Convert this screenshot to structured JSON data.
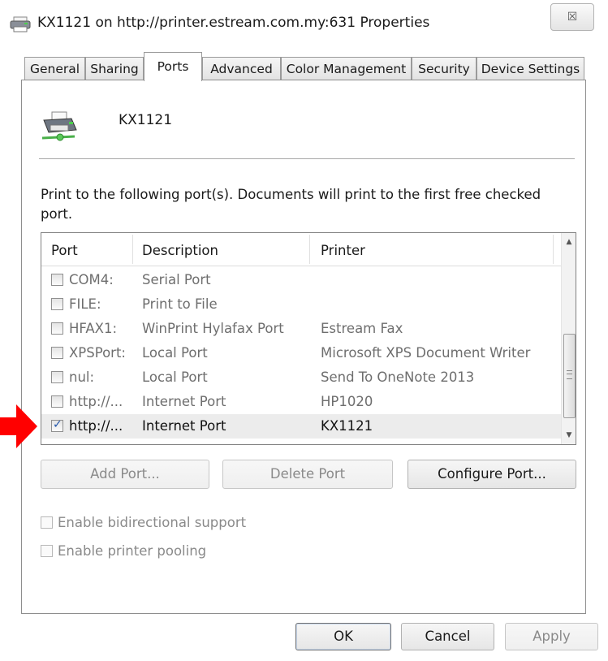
{
  "window": {
    "title": "KX1121 on http://printer.estream.com.my:631 Properties",
    "close_glyph": "☒",
    "icons": {
      "title": "printer-icon",
      "close": "close-icon"
    }
  },
  "tabs": [
    {
      "label": "General",
      "active": false
    },
    {
      "label": "Sharing",
      "active": false
    },
    {
      "label": "Ports",
      "active": true
    },
    {
      "label": "Advanced",
      "active": false
    },
    {
      "label": "Color Management",
      "active": false
    },
    {
      "label": "Security",
      "active": false
    },
    {
      "label": "Device Settings",
      "active": false
    }
  ],
  "printer": {
    "name": "KX1121",
    "icon": "network-printer-icon"
  },
  "description": "Print to the following port(s). Documents will print to the first free checked port.",
  "port_list": {
    "headers": {
      "port": "Port",
      "description": "Description",
      "printer": "Printer"
    },
    "rows": [
      {
        "port": "COM4:",
        "description": "Serial Port",
        "printer": "",
        "checked": false,
        "selected": false
      },
      {
        "port": "FILE:",
        "description": "Print to File",
        "printer": "",
        "checked": false,
        "selected": false
      },
      {
        "port": "HFAX1:",
        "description": "WinPrint Hylafax Port",
        "printer": "Estream Fax",
        "checked": false,
        "selected": false
      },
      {
        "port": "XPSPort:",
        "description": "Local Port",
        "printer": "Microsoft XPS Document Writer",
        "checked": false,
        "selected": false
      },
      {
        "port": "nul:",
        "description": "Local Port",
        "printer": "Send To OneNote 2013",
        "checked": false,
        "selected": false
      },
      {
        "port": "http://...",
        "description": "Internet Port",
        "printer": "HP1020",
        "checked": false,
        "selected": false
      },
      {
        "port": "http://...",
        "description": "Internet Port",
        "printer": "KX1121",
        "checked": true,
        "selected": true
      }
    ],
    "scroll_up": "▲",
    "scroll_down": "▼"
  },
  "buttons": {
    "add_port": "Add Port...",
    "delete_port": "Delete Port",
    "configure_port": "Configure Port...",
    "ok": "OK",
    "cancel": "Cancel",
    "apply": "Apply"
  },
  "options": {
    "bidirectional": {
      "label": "Enable bidirectional support",
      "checked": false,
      "enabled": false
    },
    "pooling": {
      "label": "Enable printer pooling",
      "checked": false,
      "enabled": false
    }
  },
  "annotation": {
    "color": "#ff0000",
    "icon": "red-arrow-icon"
  }
}
